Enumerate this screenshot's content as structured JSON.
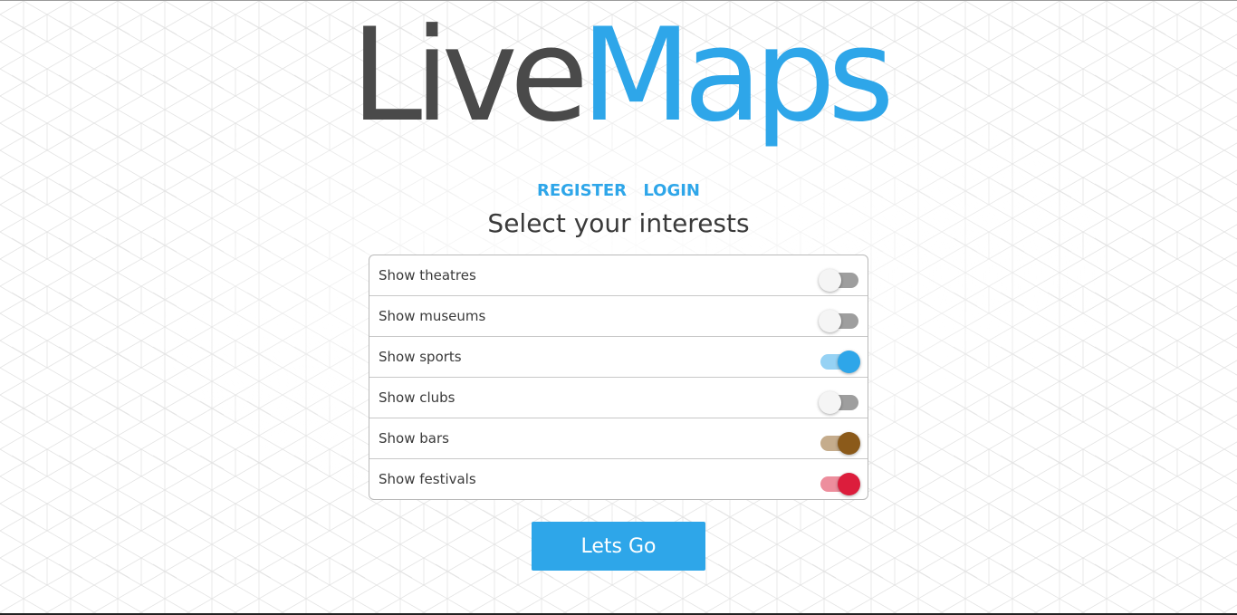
{
  "logo": {
    "part1": "Live",
    "part2": "Maps"
  },
  "auth": {
    "register": "REGISTER",
    "login": "LOGIN"
  },
  "heading": "Select your interests",
  "interests": [
    {
      "label": "Show theatres",
      "on": false,
      "color": "#9e9e9e"
    },
    {
      "label": "Show museums",
      "on": false,
      "color": "#9e9e9e"
    },
    {
      "label": "Show sports",
      "on": true,
      "color": "#2ea6e9"
    },
    {
      "label": "Show clubs",
      "on": false,
      "color": "#9e9e9e"
    },
    {
      "label": "Show bars",
      "on": true,
      "color": "#8b5a1a"
    },
    {
      "label": "Show festivals",
      "on": true,
      "color": "#dc1d3c"
    }
  ],
  "cta": {
    "label": "Lets Go"
  },
  "colors": {
    "accent": "#2ea6e9",
    "logo_dark": "#4a4a4a"
  }
}
